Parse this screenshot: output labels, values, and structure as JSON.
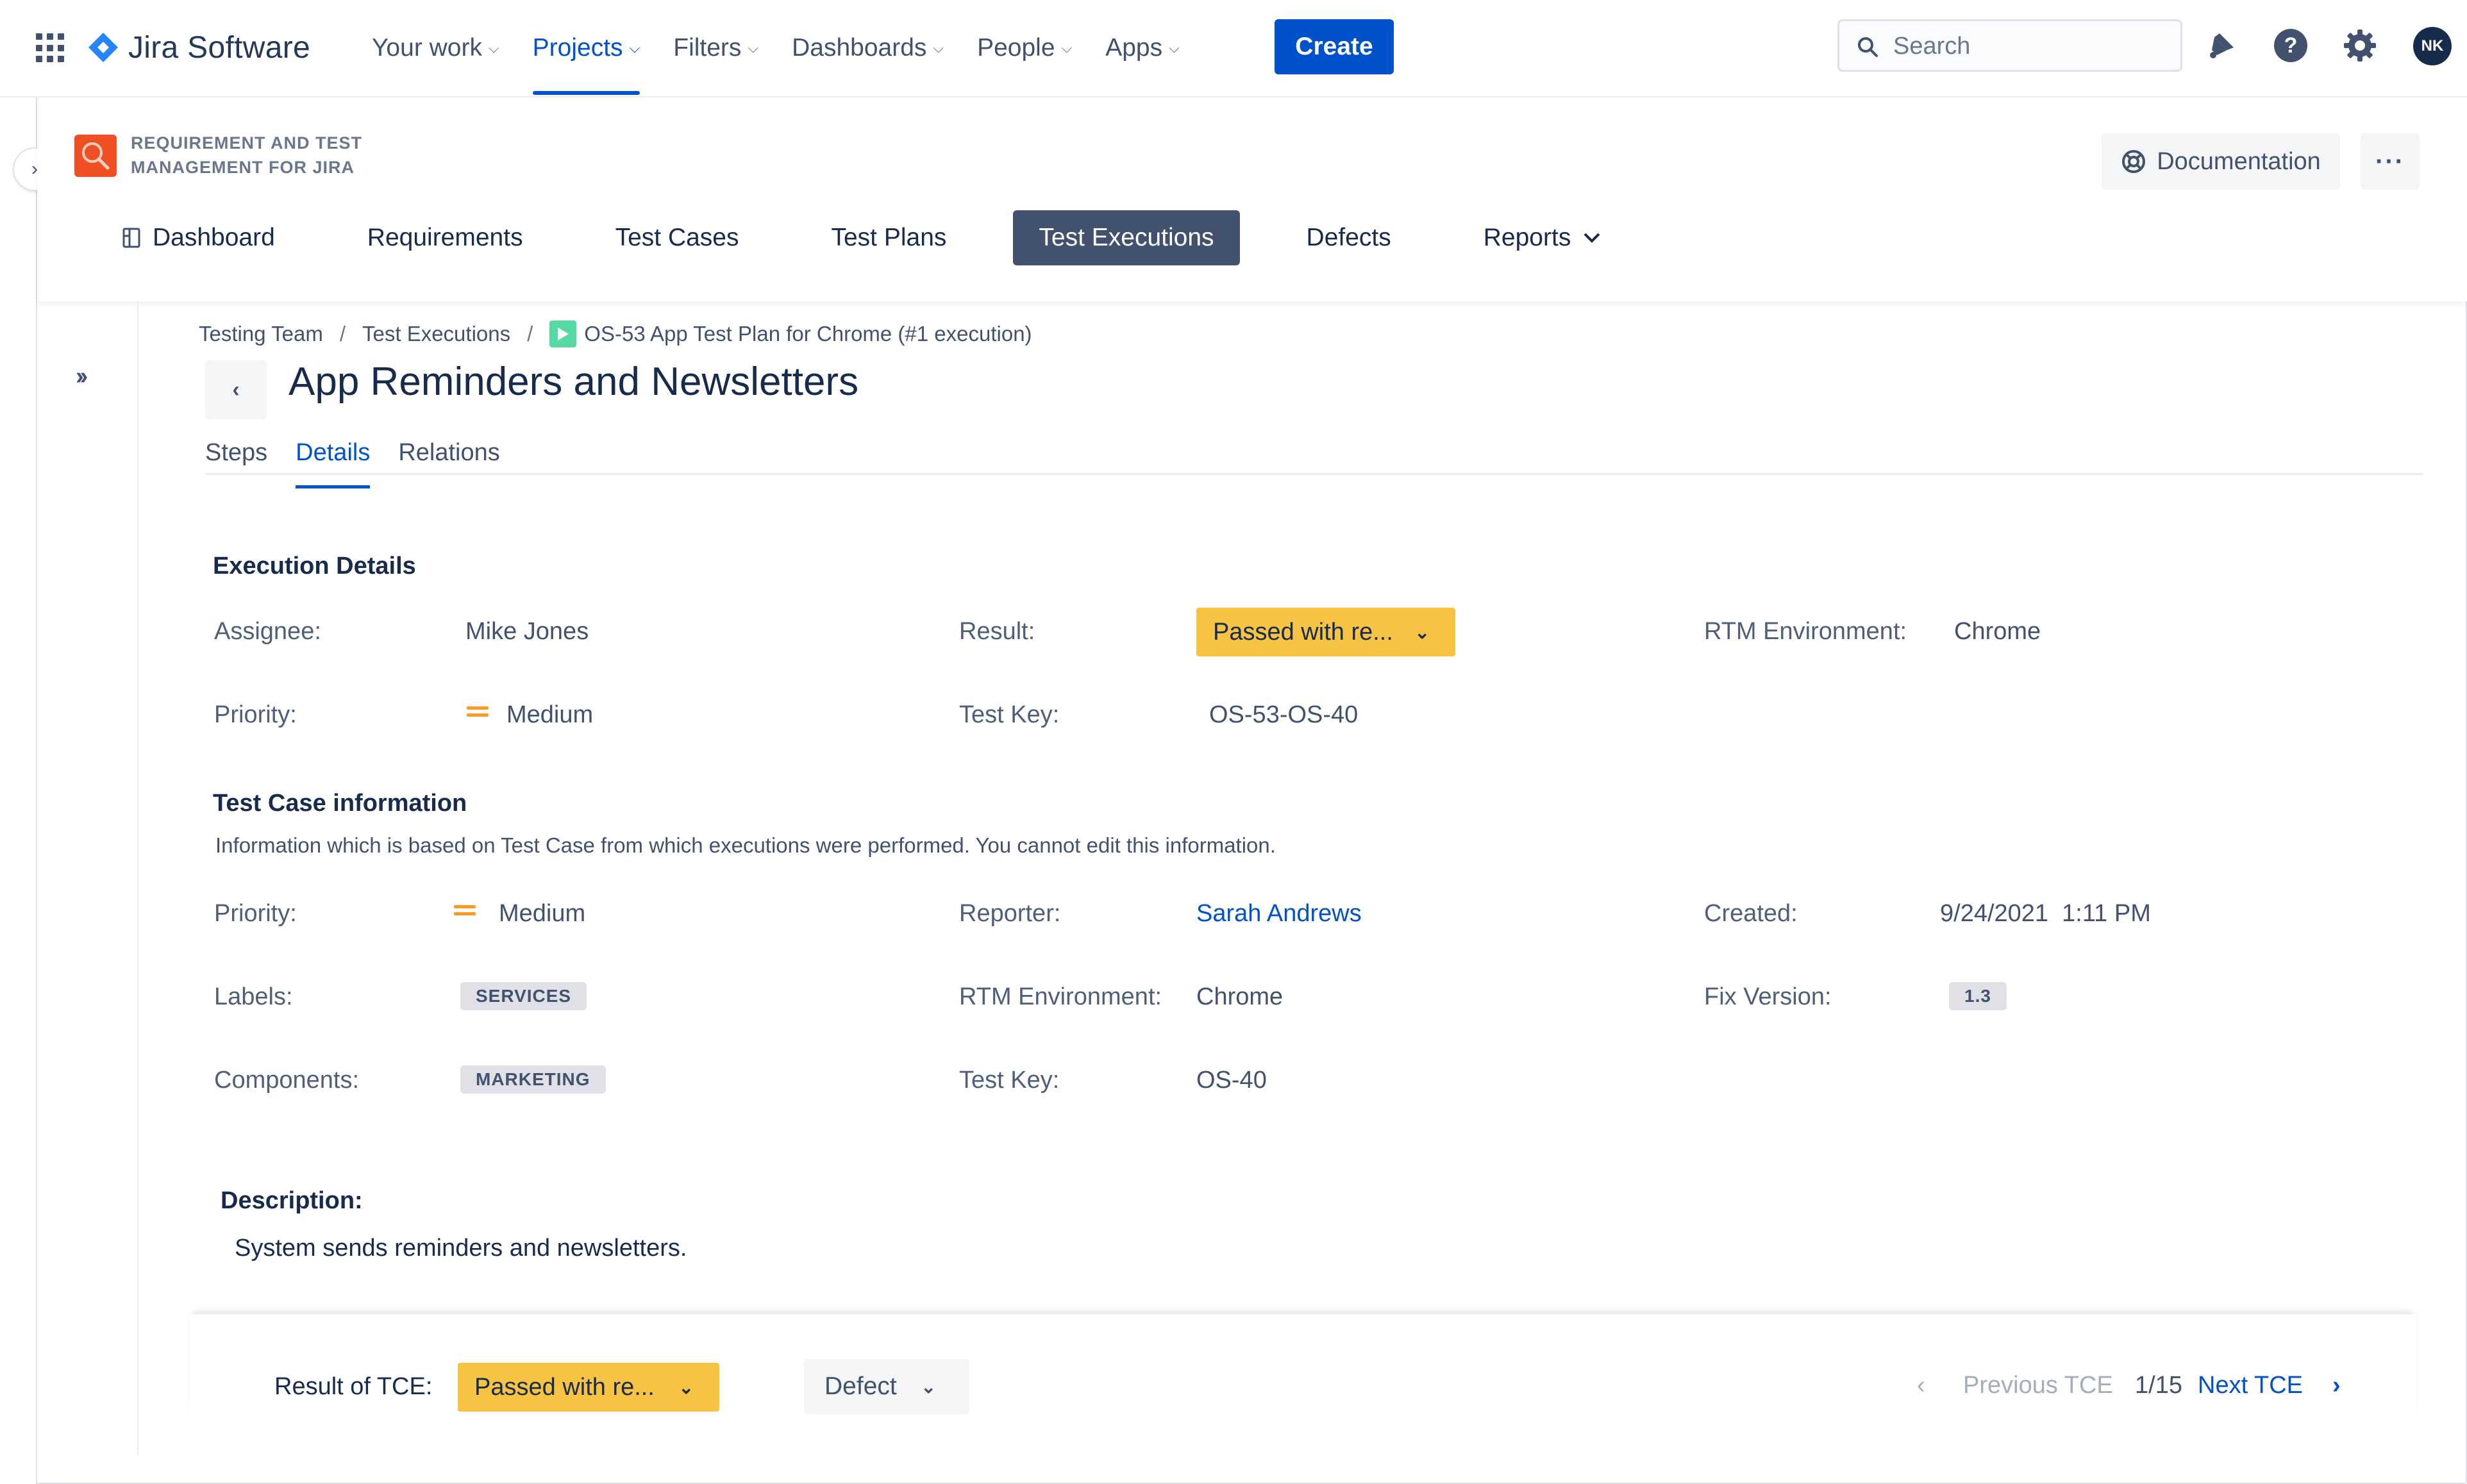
{
  "topnav": {
    "product": "Jira Software",
    "items": [
      {
        "label": "Your work",
        "active": false
      },
      {
        "label": "Projects",
        "active": true
      },
      {
        "label": "Filters",
        "active": false
      },
      {
        "label": "Dashboards",
        "active": false
      },
      {
        "label": "People",
        "active": false
      },
      {
        "label": "Apps",
        "active": false
      }
    ],
    "create_label": "Create",
    "search_placeholder": "Search",
    "avatar_initials": "NK"
  },
  "app": {
    "name_line1": "REQUIREMENT AND TEST",
    "name_line2": "MANAGEMENT FOR JIRA",
    "documentation_label": "Documentation",
    "more_label": "···",
    "tabs": [
      {
        "label": "Dashboard",
        "active": false
      },
      {
        "label": "Requirements",
        "active": false
      },
      {
        "label": "Test Cases",
        "active": false
      },
      {
        "label": "Test Plans",
        "active": false
      },
      {
        "label": "Test Executions",
        "active": true
      },
      {
        "label": "Defects",
        "active": false
      },
      {
        "label": "Reports",
        "active": false
      }
    ]
  },
  "breadcrumb": {
    "items": [
      "Testing Team",
      "Test Executions",
      "OS-53 App Test Plan for Chrome (#1 execution)"
    ],
    "separator": "/"
  },
  "page": {
    "title": "App Reminders and Newsletters",
    "subtabs": [
      {
        "label": "Steps",
        "active": false
      },
      {
        "label": "Details",
        "active": true
      },
      {
        "label": "Relations",
        "active": false
      }
    ]
  },
  "execution_details": {
    "title": "Execution Details",
    "assignee_label": "Assignee:",
    "assignee_value": "Mike Jones",
    "result_label": "Result:",
    "result_value": "Passed with re...",
    "env_label": "RTM Environment:",
    "env_value": "Chrome",
    "priority_label": "Priority:",
    "priority_value": "Medium",
    "testkey_label": "Test Key:",
    "testkey_value": "OS-53-OS-40"
  },
  "test_case_info": {
    "title": "Test Case information",
    "help": "Information which is based on Test Case from which executions were performed. You cannot edit this information.",
    "priority_label": "Priority:",
    "priority_value": "Medium",
    "reporter_label": "Reporter:",
    "reporter_value": "Sarah Andrews",
    "created_label": "Created:",
    "created_value": "9/24/2021  1:11 PM",
    "labels_label": "Labels:",
    "labels_value": "SERVICES",
    "env_label": "RTM Environment:",
    "env_value": "Chrome",
    "fixversion_label": "Fix Version:",
    "fixversion_value": "1.3",
    "components_label": "Components:",
    "components_value": "MARKETING",
    "testkey_label": "Test Key:",
    "testkey_value": "OS-40"
  },
  "description": {
    "title": "Description:",
    "text": "System sends reminders and newsletters."
  },
  "bottombar": {
    "result_label": "Result of TCE:",
    "result_value": "Passed with re...",
    "defect_label": "Defect",
    "prev_label": "Previous TCE",
    "page_indicator": "1/15",
    "next_label": "Next TCE"
  },
  "colors": {
    "brand": "#0052cc",
    "result_yellow": "#f6c342",
    "priority_medium": "#ff991f",
    "active_tab": "#42526e",
    "app_logo": "#f04e23"
  }
}
